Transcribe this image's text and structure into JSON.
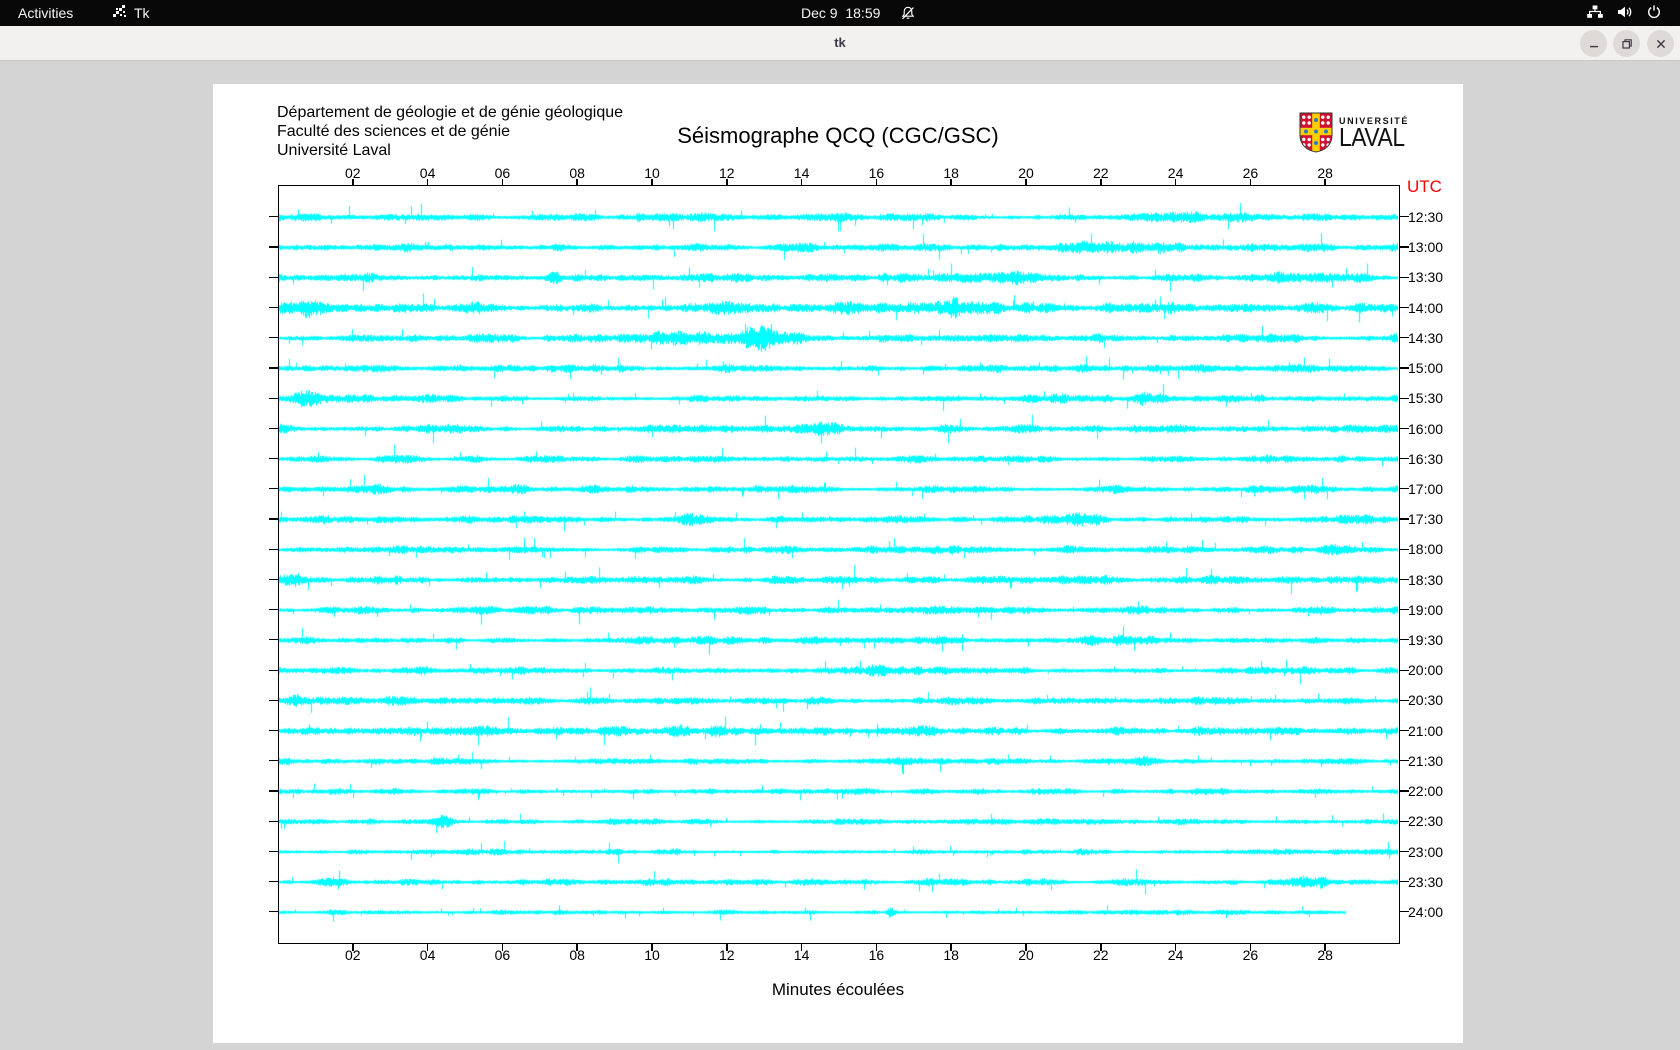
{
  "topbar": {
    "activities_label": "Activities",
    "app_name": "Tk",
    "clock": "Dec 9  18:59"
  },
  "window": {
    "title": "tk"
  },
  "panel": {
    "org_lines": [
      "Département de géologie et de génie géologique",
      "Faculté des sciences et de génie",
      "Université Laval"
    ],
    "logo": {
      "line1": "UNIVERSITÉ",
      "line2": "LAVAL"
    }
  },
  "chart_data": {
    "type": "line",
    "title": "Séismographe QCQ (CGC/GSC)",
    "xlabel": "Minutes écoulées",
    "right_axis_title": "UTC",
    "utc_color": "#ff0000",
    "trace_color": "#00ffff",
    "axis_color": "#000000",
    "x_range_minutes": [
      0,
      30
    ],
    "x_ticks": [
      "02",
      "04",
      "06",
      "08",
      "10",
      "12",
      "14",
      "16",
      "18",
      "20",
      "22",
      "24",
      "26",
      "28"
    ],
    "traces": [
      {
        "label": "12:30",
        "activity": 0.95,
        "events": [
          [
            24.5,
            1.8,
            1.5
          ]
        ]
      },
      {
        "label": "13:00",
        "activity": 1.0,
        "events": [
          [
            22.5,
            1.9,
            2.0
          ],
          [
            3.0,
            1.5,
            0.8
          ]
        ]
      },
      {
        "label": "13:30",
        "activity": 1.05,
        "events": [
          [
            7.4,
            2.6,
            0.25
          ],
          [
            19.5,
            1.6,
            3.0
          ],
          [
            26.5,
            1.7,
            1.2
          ]
        ]
      },
      {
        "label": "14:00",
        "activity": 1.45,
        "events": [
          [
            1.0,
            1.8,
            1.0
          ],
          [
            17.5,
            1.9,
            2.5
          ],
          [
            25.8,
            1.7,
            1.0
          ]
        ]
      },
      {
        "label": "14:30",
        "activity": 1.05,
        "events": [
          [
            11.5,
            2.6,
            2.2
          ],
          [
            13.5,
            2.0,
            1.5
          ]
        ]
      },
      {
        "label": "15:00",
        "activity": 0.9,
        "events": [
          [
            27.5,
            1.8,
            0.6
          ]
        ]
      },
      {
        "label": "15:30",
        "activity": 1.0,
        "events": [
          [
            0.8,
            1.9,
            0.6
          ],
          [
            23.0,
            1.5,
            1.5
          ]
        ]
      },
      {
        "label": "16:00",
        "activity": 1.05,
        "events": [
          [
            15.0,
            1.8,
            1.5
          ]
        ]
      },
      {
        "label": "16:30",
        "activity": 0.85,
        "events": [
          [
            26.0,
            1.5,
            0.8
          ]
        ]
      },
      {
        "label": "17:00",
        "activity": 0.9,
        "events": [
          [
            2.6,
            1.7,
            0.4
          ],
          [
            6.5,
            1.5,
            0.5
          ]
        ]
      },
      {
        "label": "17:30",
        "activity": 1.0,
        "events": [
          [
            11.0,
            1.8,
            0.4
          ],
          [
            21.5,
            1.5,
            1.0
          ]
        ]
      },
      {
        "label": "18:00",
        "activity": 0.9,
        "events": [
          [
            28.0,
            1.8,
            0.5
          ]
        ]
      },
      {
        "label": "18:30",
        "activity": 1.0,
        "events": [
          [
            0.5,
            1.7,
            0.6
          ],
          [
            21.0,
            1.6,
            1.2
          ]
        ]
      },
      {
        "label": "19:00",
        "activity": 0.95,
        "events": [
          [
            7.0,
            2.0,
            0.5
          ]
        ]
      },
      {
        "label": "19:30",
        "activity": 0.9,
        "events": [
          [
            21.8,
            2.2,
            0.4
          ],
          [
            22.6,
            1.8,
            0.3
          ]
        ]
      },
      {
        "label": "20:00",
        "activity": 0.9,
        "events": [
          [
            16.2,
            1.7,
            0.8
          ],
          [
            20.0,
            1.8,
            0.4
          ]
        ]
      },
      {
        "label": "20:30",
        "activity": 1.0,
        "events": [
          [
            0.5,
            1.8,
            0.5
          ],
          [
            22.0,
            1.6,
            0.8
          ]
        ]
      },
      {
        "label": "21:00",
        "activity": 1.1,
        "events": [
          [
            10.8,
            1.7,
            1.5
          ]
        ]
      },
      {
        "label": "21:30",
        "activity": 0.8,
        "events": [
          [
            23.0,
            1.6,
            0.6
          ]
        ]
      },
      {
        "label": "22:00",
        "activity": 0.7,
        "events": [
          [
            20.0,
            1.4,
            1.0
          ]
        ]
      },
      {
        "label": "22:30",
        "activity": 0.7,
        "events": [
          [
            4.4,
            2.2,
            0.3
          ],
          [
            19.0,
            1.5,
            0.8
          ]
        ]
      },
      {
        "label": "23:00",
        "activity": 0.7,
        "events": [
          [
            9.0,
            2.2,
            0.3
          ],
          [
            21.5,
            1.5,
            0.6
          ]
        ]
      },
      {
        "label": "23:30",
        "activity": 0.8,
        "events": [
          [
            1.2,
            1.7,
            0.5
          ],
          [
            17.4,
            2.4,
            0.2
          ],
          [
            27.6,
            2.2,
            1.0
          ]
        ]
      },
      {
        "label": "24:00",
        "activity": 0.6,
        "end_minute": 28.6,
        "events": [
          [
            16.4,
            3.0,
            0.15
          ],
          [
            21.0,
            1.6,
            0.5
          ]
        ]
      }
    ]
  }
}
